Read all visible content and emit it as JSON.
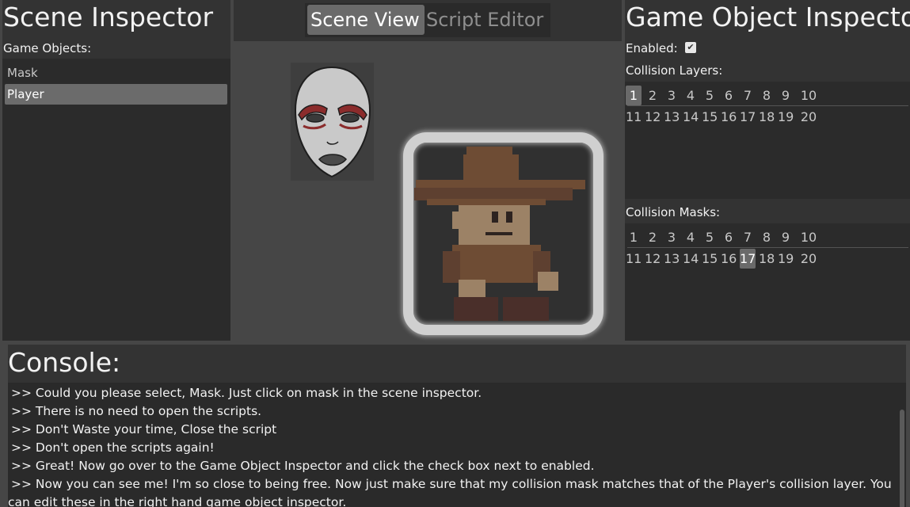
{
  "scene_inspector": {
    "title": "Scene Inspector",
    "list_label": "Game Objects:",
    "objects": [
      "Mask",
      "Player"
    ],
    "selected": "Player"
  },
  "tabs": [
    "Scene View",
    "Script Editor"
  ],
  "active_tab": "Scene View",
  "go_inspector": {
    "title": "Game Object Inspector",
    "enabled_label": "Enabled:",
    "enabled_checked": "✔",
    "collision_layers_label": "Collision Layers:",
    "collision_masks_label": "Collision Masks:",
    "numbers": [
      "1",
      "2",
      "3",
      "4",
      "5",
      "6",
      "7",
      "8",
      "9",
      "10",
      "11",
      "12",
      "13",
      "14",
      "15",
      "16",
      "17",
      "18",
      "19",
      "20"
    ],
    "selected_layer": 1,
    "selected_mask": 17
  },
  "console": {
    "title": "Console:",
    "lines": [
      ">> Could you please select, Mask. Just click on mask in the scene inspector.",
      ">> There is no need to open the scripts.",
      ">> Don't Waste your time, Close the script",
      ">> Don't open the scripts again!",
      ">> Great! Now go over to the Game Object Inspector and click the check box next to enabled.",
      ">> Now you can see me! I'm so close to being free. Now just make sure that my collision mask matches that of the Player's collision layer. You",
      "can edit these in the right hand game object inspector."
    ]
  },
  "colors": {
    "mask_red": "#8b2c2c",
    "player_hat": "#6e4c34",
    "player_skin": "#9c8266"
  }
}
